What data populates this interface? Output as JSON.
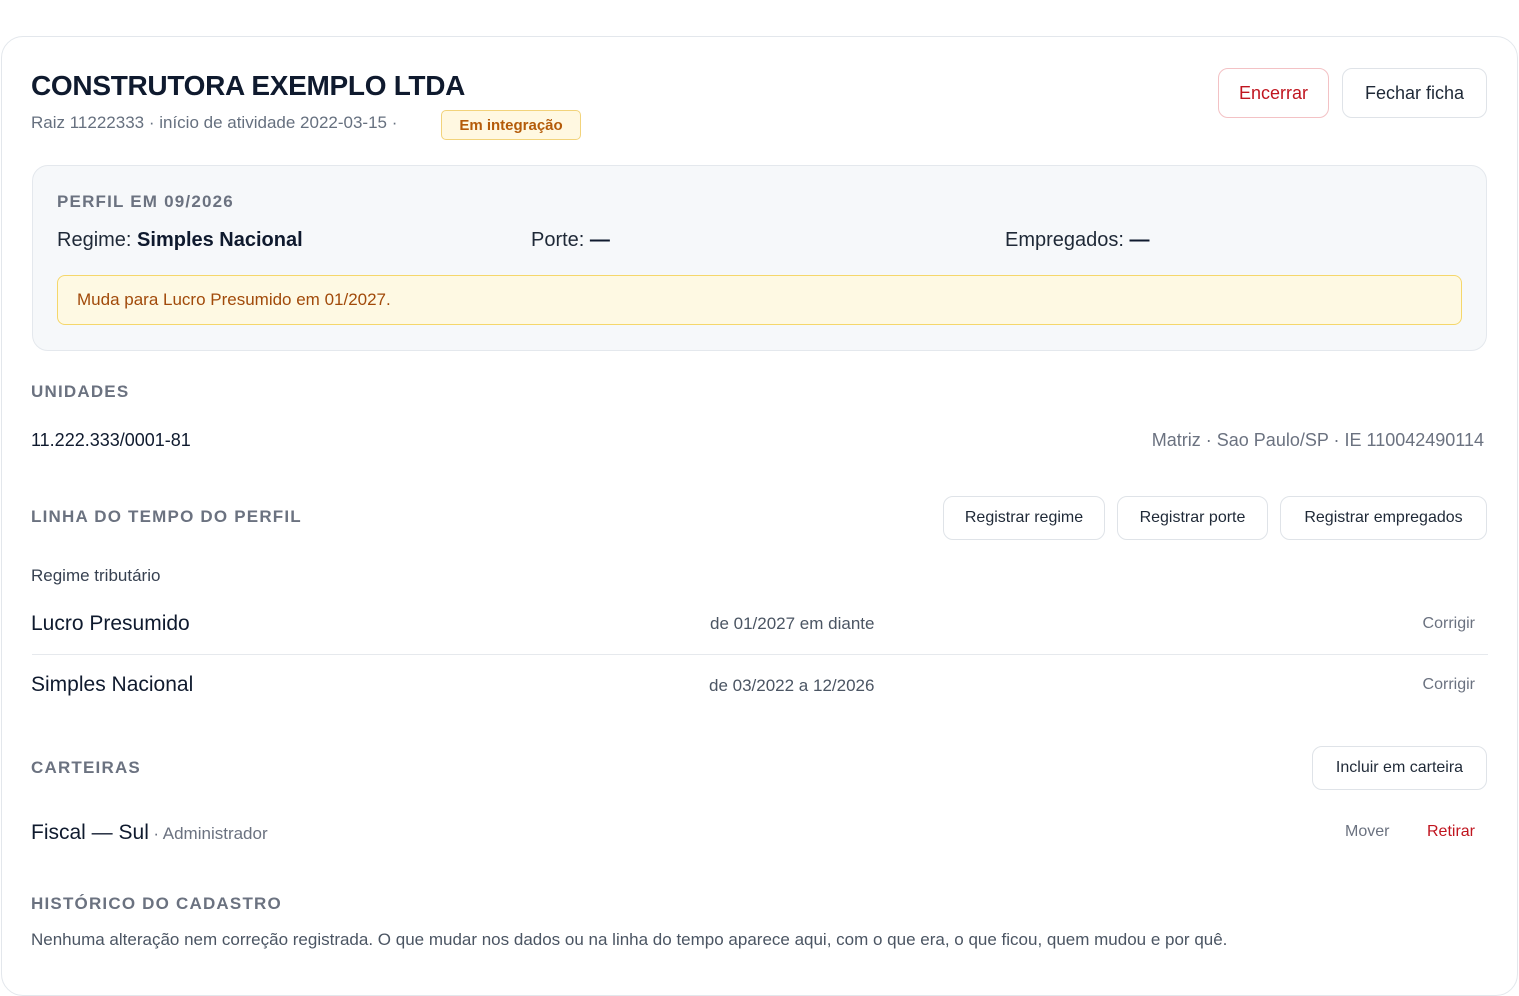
{
  "header": {
    "title": "CONSTRUTORA EXEMPLO LTDA",
    "subline": "Raiz 11222333 · início de atividade 2022-03-15 ·",
    "status_badge": "Em integração",
    "close_action_label": "Encerrar",
    "close_sheet_label": "Fechar ficha"
  },
  "profile": {
    "caption": "PERFIL EM 09/2026",
    "regime_label": "Regime:",
    "regime_value": "Simples Nacional",
    "porte_label": "Porte:",
    "porte_value": "—",
    "empregados_label": "Empregados:",
    "empregados_value": "—",
    "notice": "Muda para Lucro Presumido em 01/2027."
  },
  "units": {
    "caption": "UNIDADES",
    "items": [
      {
        "cnpj": "11.222.333/0001-81",
        "details": "Matriz · Sao Paulo/SP · IE 110042490114"
      }
    ]
  },
  "timeline": {
    "caption": "LINHA DO TEMPO DO PERFIL",
    "buttons": {
      "regime": "Registrar regime",
      "porte": "Registrar porte",
      "empregados": "Registrar empregados"
    },
    "group_label": "Regime tributário",
    "rows": [
      {
        "name": "Lucro Presumido",
        "period": "de 01/2027 em diante",
        "action": "Corrigir"
      },
      {
        "name": "Simples Nacional",
        "period": "de 03/2022 a 12/2026",
        "action": "Corrigir"
      }
    ]
  },
  "portfolios": {
    "caption": "CARTEIRAS",
    "add_button": "Incluir em carteira",
    "items": [
      {
        "name": "Fiscal — Sul",
        "role": "· Administrador",
        "move": "Mover",
        "remove": "Retirar"
      }
    ]
  },
  "history": {
    "caption": "HISTÓRICO DO CADASTRO",
    "empty_text": "Nenhuma alteração nem correção registrada. O que mudar nos dados ou na linha do tempo aparece aqui, com o que era, o que ficou, quem mudou e por quê."
  }
}
